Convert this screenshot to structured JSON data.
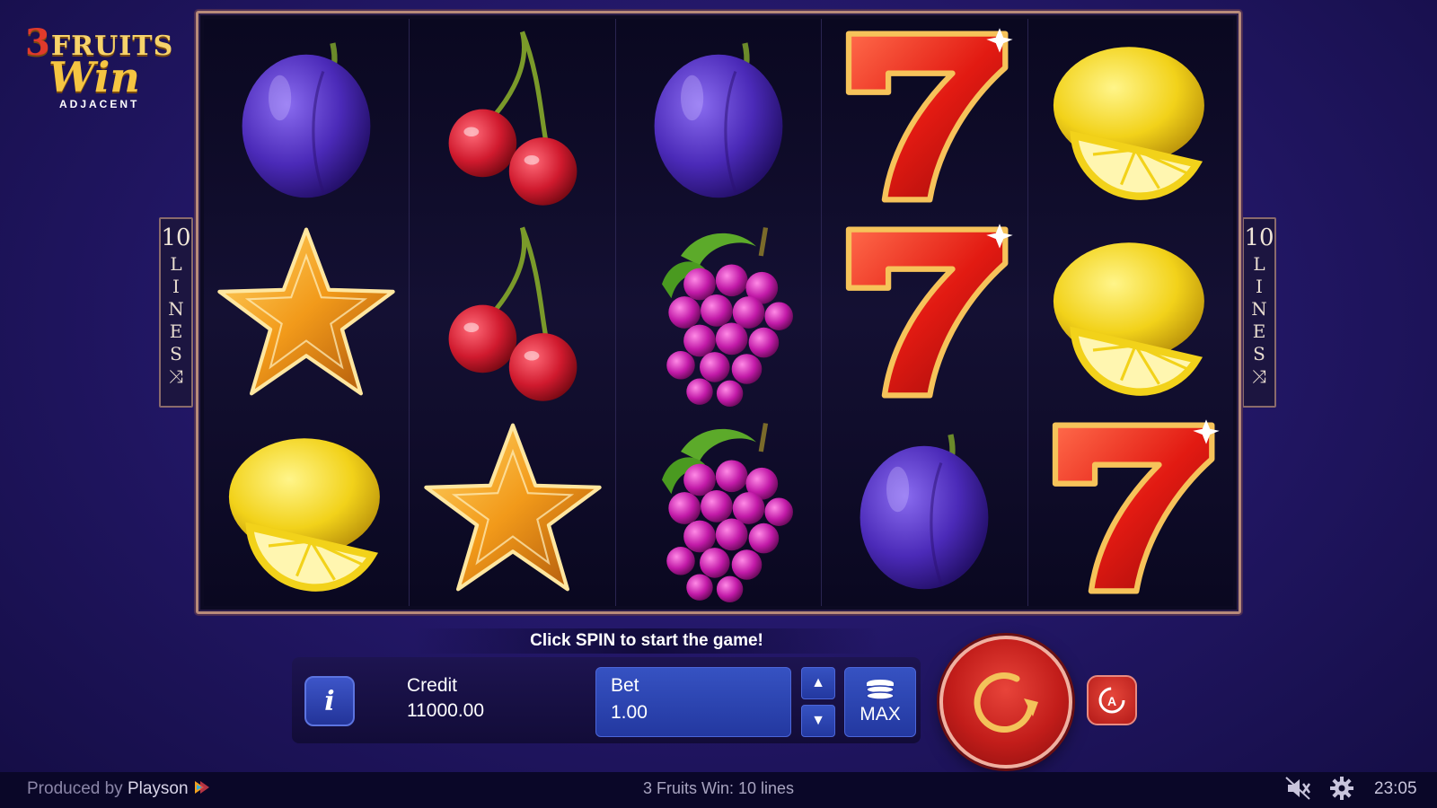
{
  "logo": {
    "number": "3",
    "line1": "FRUITS",
    "line2": "Win",
    "line3": "ADJACENT"
  },
  "reels": [
    [
      "plum",
      "star",
      "lemon"
    ],
    [
      "cherry",
      "cherry",
      "star"
    ],
    [
      "plum",
      "grapes",
      "grapes"
    ],
    [
      "seven",
      "seven",
      "plum"
    ],
    [
      "lemon",
      "lemon",
      "seven"
    ]
  ],
  "lines_panel": {
    "count": "10",
    "letters": [
      "L",
      "I",
      "N",
      "E",
      "S"
    ]
  },
  "status_message": "Click SPIN to start the game!",
  "credit": {
    "label": "Credit",
    "value": "11000.00"
  },
  "bet": {
    "label": "Bet",
    "value": "1.00"
  },
  "max_button": {
    "label": "MAX"
  },
  "footer": {
    "produced_prefix": "Produced by",
    "produced_brand": "Playson",
    "game_title": "3 Fruits Win: 10 lines",
    "clock": "23:05"
  },
  "colors": {
    "frame": "#b78a7a",
    "spin_red": "#c21d1a",
    "button_blue": "#2d45b0",
    "background": "#24186a"
  }
}
